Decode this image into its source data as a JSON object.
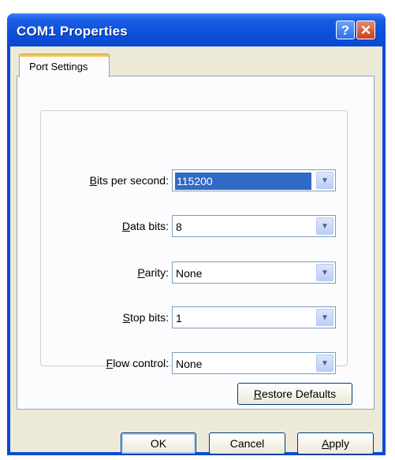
{
  "window": {
    "title": "COM1 Properties",
    "help_glyph": "?",
    "close_glyph": "✕"
  },
  "tabs": [
    {
      "label": "Port Settings",
      "active": true
    }
  ],
  "fields": [
    {
      "mnemonic": "B",
      "label_rest": "its per second:",
      "value": "115200",
      "focused": true
    },
    {
      "mnemonic": "D",
      "label_rest": "ata bits:",
      "value": "8"
    },
    {
      "mnemonic": "P",
      "label_rest": "arity:",
      "value": "None"
    },
    {
      "mnemonic": "S",
      "label_rest": "top bits:",
      "value": "1"
    },
    {
      "mnemonic": "F",
      "label_rest": "low control:",
      "value": "None"
    }
  ],
  "restore": {
    "mnemonic": "R",
    "label_rest": "estore Defaults"
  },
  "footer": {
    "ok_label": "OK",
    "cancel_label": "Cancel",
    "apply_mnemonic": "A",
    "apply_rest": "pply"
  },
  "icons": {
    "dropdown": "chevron-down-icon"
  },
  "colors": {
    "titlebar": "#0a4ad2",
    "selection": "#316ac5",
    "face": "#ece9d8"
  }
}
